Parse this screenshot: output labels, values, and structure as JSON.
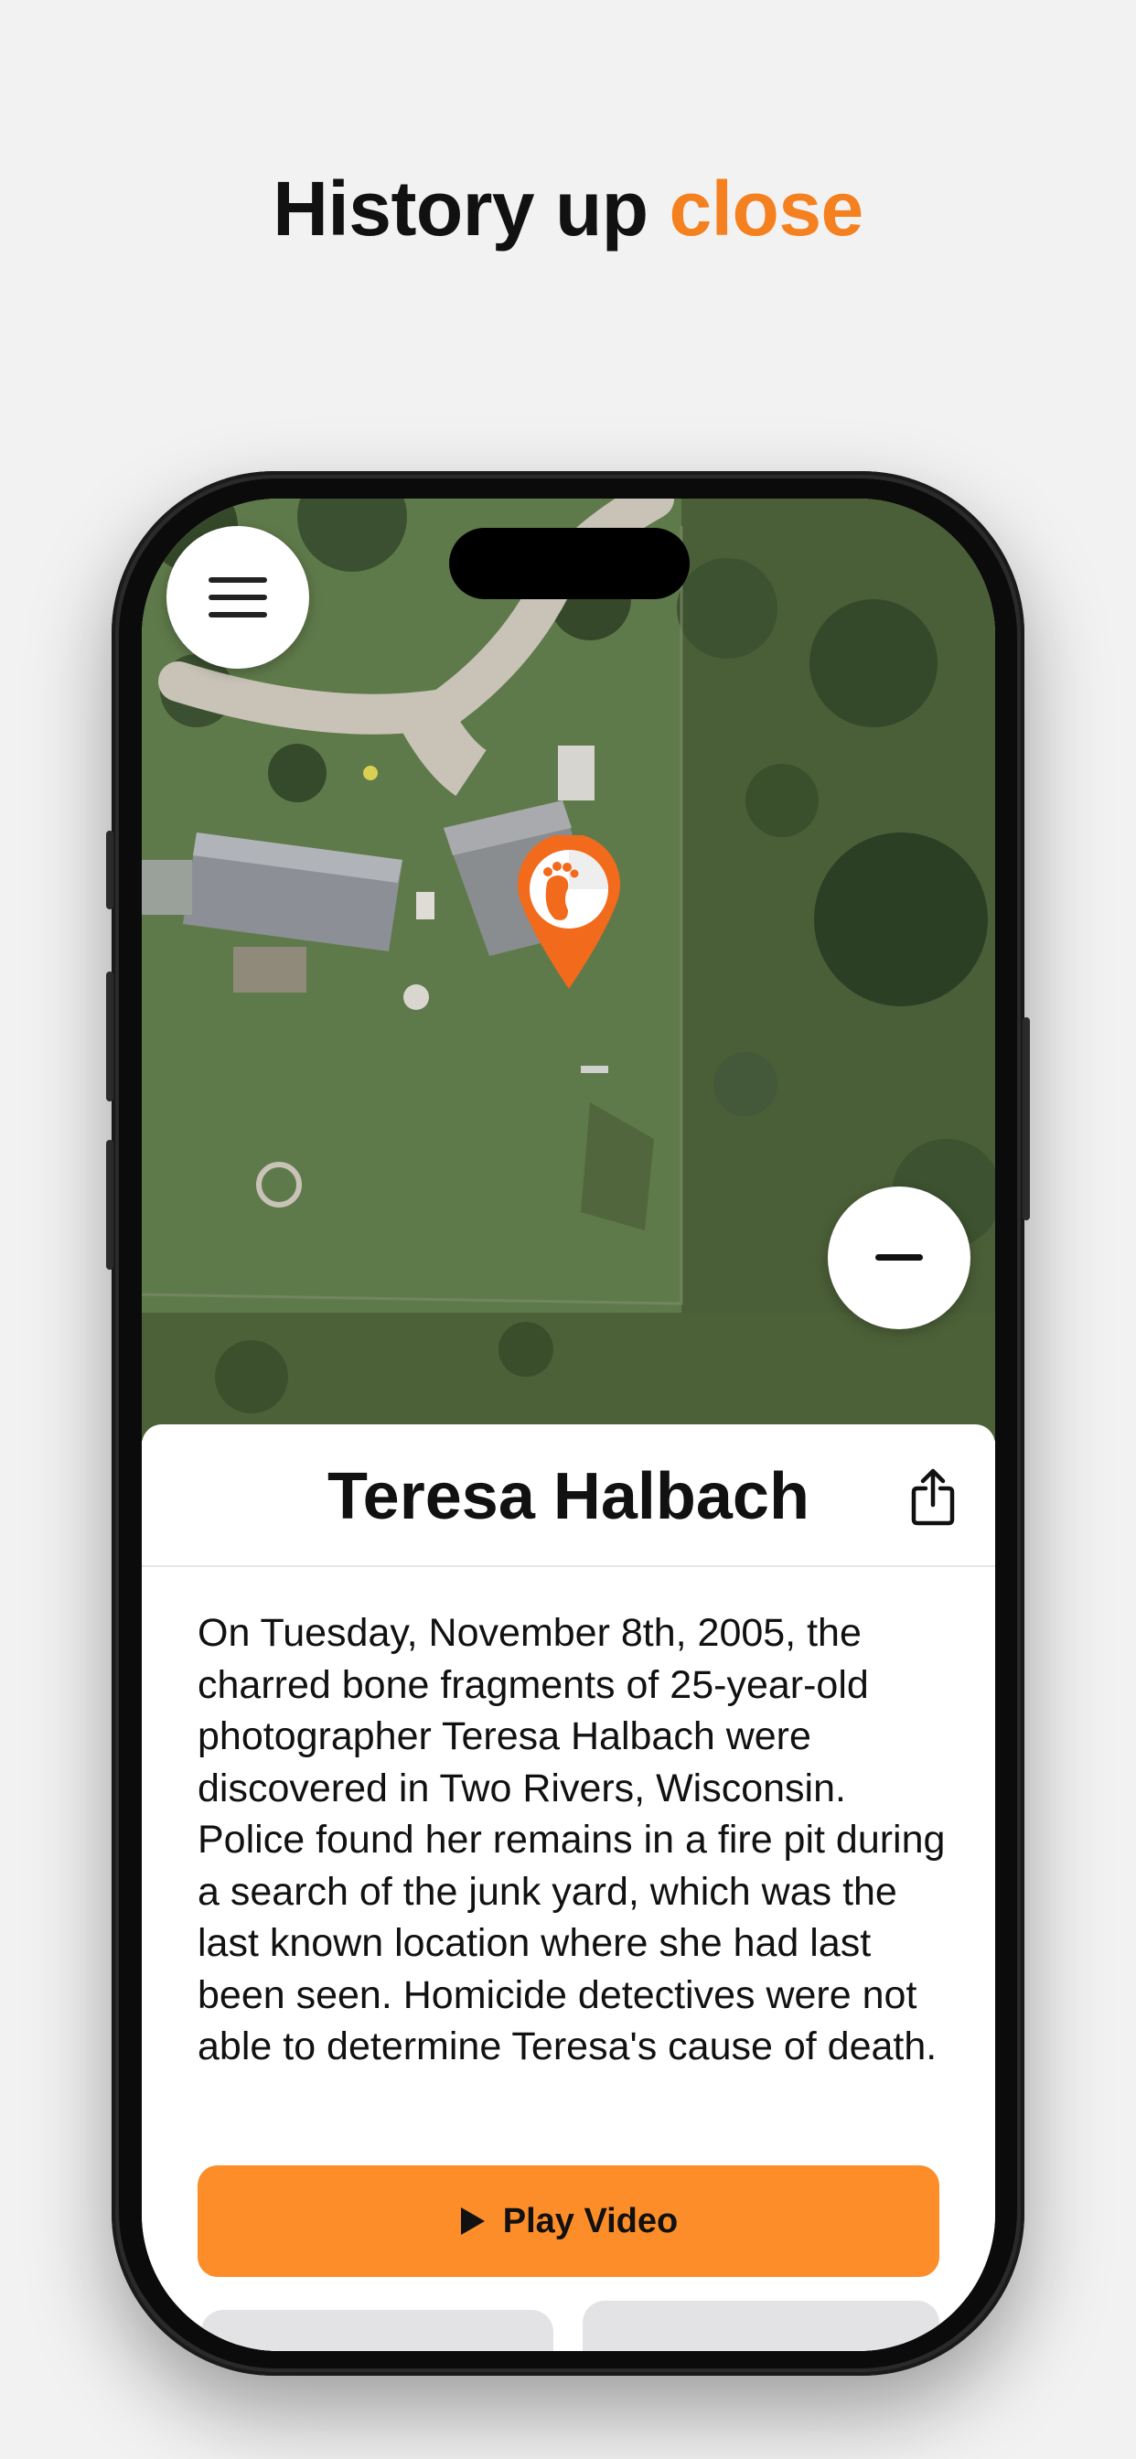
{
  "headline": {
    "text": "History up",
    "accent": "close"
  },
  "colors": {
    "accent": "#f5801f",
    "button": "#fd8d28",
    "background": "#f2f2f2"
  },
  "map": {
    "menu_icon": "hamburger-menu-icon",
    "zoom_out_icon": "minus-icon",
    "pin_icon": "footprint-pin-icon"
  },
  "sheet": {
    "title": "Teresa Halbach",
    "share_icon": "share-icon",
    "description": "On Tuesday, November 8th, 2005, the charred bone fragments of 25-year-old photographer Teresa Halbach were discovered in Two Rivers, Wisconsin. Police found her remains in a fire pit during a search of the junk yard, which was the last known location where she had last been seen. Homicide detectives were not able to determine Teresa's cause of death.",
    "play_button_label": "Play Video",
    "play_icon": "play-icon"
  }
}
